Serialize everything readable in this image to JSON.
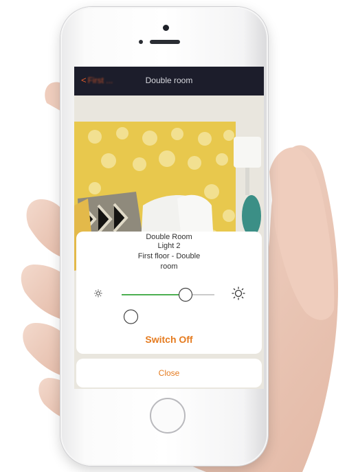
{
  "navbar": {
    "back_label": "First ...",
    "back_glyph": "<",
    "title": "Double room"
  },
  "popup": {
    "room_name": "Double Room",
    "light_name": "Light 2",
    "location_line1": "First floor - Double",
    "location_line2": "room",
    "brightness_level": 0.72,
    "color_position": 0.24,
    "switch_label": "Switch Off"
  },
  "close_label": "Close",
  "icons": {
    "brightness_low": "sun-small-icon",
    "brightness_high": "sun-large-icon",
    "back": "chevron-left-icon"
  },
  "colors": {
    "accent": "#e57b1f",
    "navbar": "#1c1d2b",
    "slider_green": "#4caf50"
  }
}
